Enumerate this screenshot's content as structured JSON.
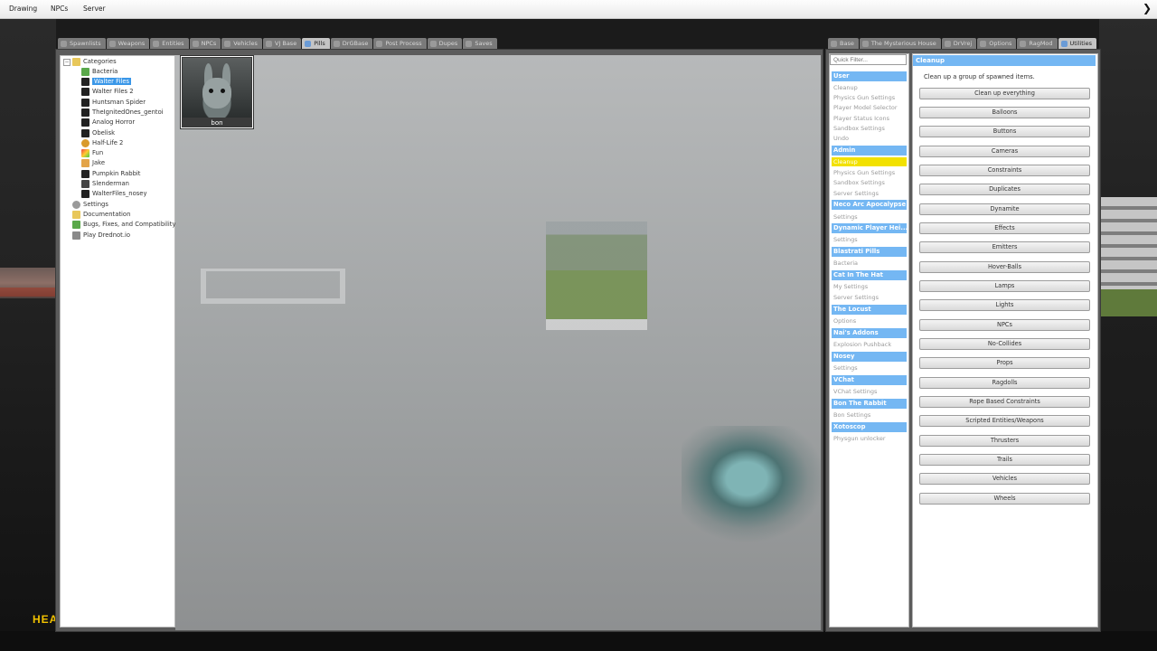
{
  "menubar": {
    "items": [
      "Drawing",
      "NPCs",
      "Server"
    ]
  },
  "hud": {
    "text": "HEA"
  },
  "spawn_tabs": [
    "Spawnlists",
    "Weapons",
    "Entities",
    "NPCs",
    "Vehicles",
    "VJ Base",
    "Pills",
    "DrGBase",
    "Post Process",
    "Dupes",
    "Saves"
  ],
  "spawn_tabs_active": "Pills",
  "tree": {
    "categories_label": "Categories",
    "items": [
      "Bacteria",
      "Walter Files",
      "Walter Files 2",
      "Huntsman Spider",
      "TheIgnitedOnes_gentoi",
      "Analog Horror",
      "Obelisk",
      "Half-Life 2",
      "Fun",
      "Jake",
      "Pumpkin Rabbit",
      "Slenderman",
      "WalterFiles_nosey"
    ],
    "selected": "Walter Files",
    "root_items": [
      "Settings",
      "Documentation",
      "Bugs, Fixes, and Compatibility",
      "Play Drednot.io"
    ]
  },
  "spawn_icon": {
    "name": "bon"
  },
  "util_tabs": [
    "Base",
    "The Mysterious House",
    "DrVrej",
    "Options",
    "RagMod",
    "Utilities"
  ],
  "util_tabs_active": "Utilities",
  "quick_filter": {
    "placeholder": "Quick Filter..."
  },
  "categories": [
    {
      "header": "User",
      "items": [
        "Cleanup",
        "Physics Gun Settings",
        "Player Model Selector",
        "Player Status Icons",
        "Sandbox Settings",
        "Undo"
      ]
    },
    {
      "header": "Admin",
      "items": [
        "Cleanup",
        "Physics Gun Settings",
        "Sandbox Settings",
        "Server Settings"
      ]
    },
    {
      "header": "Neco Arc Apocalypse",
      "items": [
        "Settings"
      ]
    },
    {
      "header": "Dynamic Player Hei...",
      "items": [
        "Settings"
      ]
    },
    {
      "header": "Blastrati Pills",
      "items": [
        "Bacteria"
      ]
    },
    {
      "header": "Cat In The Hat",
      "items": [
        "My Settings",
        "Server Settings"
      ]
    },
    {
      "header": "The Locust",
      "items": [
        "Options"
      ]
    },
    {
      "header": "Nai's Addons",
      "items": [
        "Explosion Pushback"
      ]
    },
    {
      "header": "Nosey",
      "items": [
        "Settings"
      ]
    },
    {
      "header": "VChat",
      "items": [
        "VChat Settings"
      ]
    },
    {
      "header": "Bon The Rabbit",
      "items": [
        "Bon Settings"
      ]
    },
    {
      "header": "Xotoscop",
      "items": [
        "Physgun unlocker"
      ]
    }
  ],
  "selected_category_item": "Admin/Cleanup",
  "cleanup": {
    "title": "Cleanup",
    "description": "Clean up a group of spawned items.",
    "buttons": [
      "Clean up everything",
      "Balloons",
      "Buttons",
      "Cameras",
      "Constraints",
      "Duplicates",
      "Dynamite",
      "Effects",
      "Emitters",
      "Hover-Balls",
      "Lamps",
      "Lights",
      "NPCs",
      "No-Collides",
      "Props",
      "Ragdolls",
      "Rope Based Constraints",
      "Scripted Entities/Weapons",
      "Thrusters",
      "Trails",
      "Vehicles",
      "Wheels"
    ]
  }
}
